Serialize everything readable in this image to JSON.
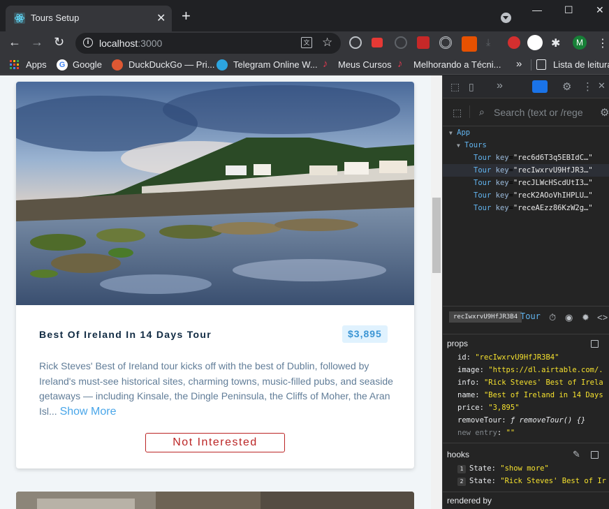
{
  "browser": {
    "tab_title": "Tours Setup",
    "tab_close": "✕",
    "new_tab": "+",
    "url_host": "localhost",
    "url_port": ":3000",
    "win_min": "—",
    "win_max": "☐",
    "win_close": "✕"
  },
  "bookmarks": [
    {
      "label": "Apps"
    },
    {
      "label": "Google"
    },
    {
      "label": "DuckDuckGo — Pri..."
    },
    {
      "label": "Telegram Online W..."
    },
    {
      "label": "Meus Cursos"
    },
    {
      "label": "Melhorando a Técni..."
    },
    {
      "label": "»"
    },
    {
      "label": "Lista de leitura"
    }
  ],
  "tour": {
    "name": "Best Of Ireland In 14 Days Tour",
    "price": "$3,895",
    "info": "Rick Steves' Best of Ireland tour kicks off with the best of Dublin, followed by Ireland's must-see historical sites, charming towns, music-filled pubs, and seaside getaways — including Kinsale, the Dingle Peninsula, the Cliffs of Moher, the Aran Isl...",
    "show_more": "Show More",
    "not_interested": "Not Interested"
  },
  "devtools": {
    "search_placeholder": "Search (text or /rege",
    "tree": {
      "app": "App",
      "tours": "Tours",
      "items": [
        {
          "name": "Tour",
          "key": "rec6d6T3q5EBIdC…"
        },
        {
          "name": "Tour",
          "key": "recIwxrvU9HfJR3…"
        },
        {
          "name": "Tour",
          "key": "recJLWcHScdUtI3…"
        },
        {
          "name": "Tour",
          "key": "recK2AOoVhIHPLU…"
        },
        {
          "name": "Tour",
          "key": "receAEzz86KzW2g…"
        }
      ]
    },
    "selected_key": "recIwxrvU9HfJR3B4",
    "selected_name": "Tour",
    "props_label": "props",
    "props": [
      {
        "key": "id",
        "value": "\"recIwxrvU9HfJR3B4\""
      },
      {
        "key": "image",
        "value": "\"https://dl.airtable.com/."
      },
      {
        "key": "info",
        "value": "\"Rick Steves' Best of Irela"
      },
      {
        "key": "name",
        "value": "\"Best of Ireland in 14 Days"
      },
      {
        "key": "price",
        "value": "\"3,895\""
      },
      {
        "key": "removeTour",
        "value": "ƒ removeTour() {}"
      }
    ],
    "new_entry": "new entry",
    "new_entry_value": "\"\"",
    "hooks_label": "hooks",
    "hooks": [
      {
        "num": "1",
        "key": "State",
        "value": "\"show more\""
      },
      {
        "num": "2",
        "key": "State",
        "value": "\"Rick Steves' Best of Ir"
      }
    ],
    "rendered_by": "rendered by"
  }
}
